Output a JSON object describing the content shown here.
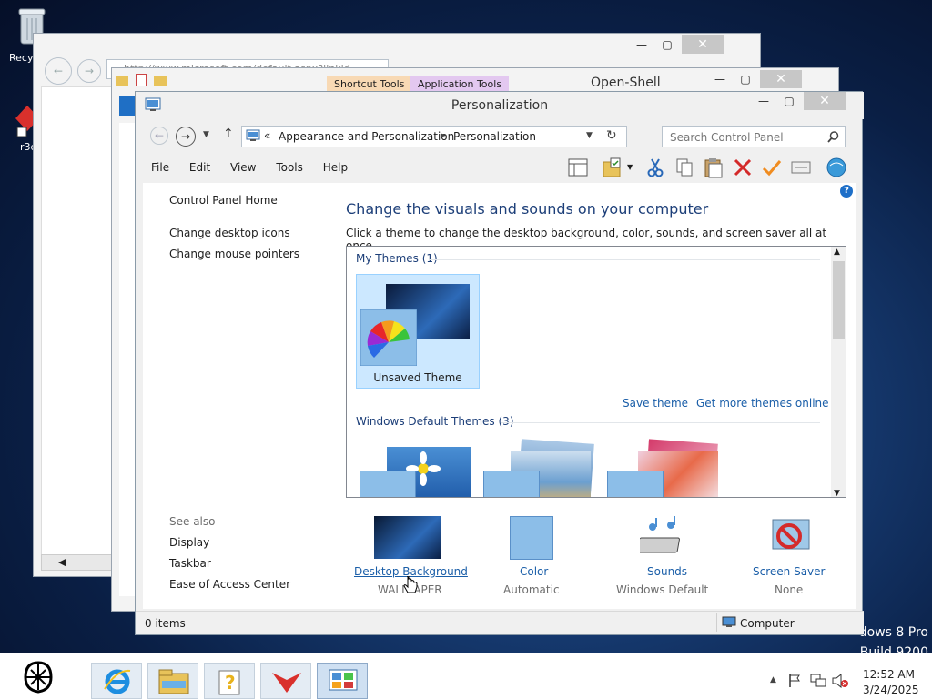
{
  "desktop": {
    "recycle_label": "Recyc",
    "app_label": "r3c",
    "watermark_line1": "dows 8 Pro",
    "watermark_line2": "Build 9200"
  },
  "bg_window_1": {
    "address_text": "http://www.microsoft.com/default.aspx?linkid=..."
  },
  "bg_window_2": {
    "shortcut_tools": "Shortcut Tools",
    "application_tools": "Application Tools",
    "title": "Open-Shell"
  },
  "window": {
    "title": "Personalization",
    "breadcrumb": {
      "root_chevron": "«",
      "item1": "Appearance and Personalization",
      "sep": "►",
      "item2": "Personalization"
    },
    "search_placeholder": "Search Control Panel",
    "menu": [
      "File",
      "Edit",
      "View",
      "Tools",
      "Help"
    ],
    "sidebar": {
      "home": "Control Panel Home",
      "links": [
        "Change desktop icons",
        "Change mouse pointers"
      ],
      "see_also_title": "See also",
      "see_also": [
        "Display",
        "Taskbar",
        "Ease of Access Center"
      ]
    },
    "main": {
      "heading": "Change the visuals and sounds on your computer",
      "subtext": "Click a theme to change the desktop background, color, sounds, and screen saver all at once.",
      "my_themes": "My Themes (1)",
      "unsaved_theme": "Unsaved Theme",
      "save_theme": "Save theme",
      "get_more": "Get more themes online",
      "default_themes": "Windows Default Themes (3)"
    },
    "bottom_items": [
      {
        "title": "Desktop Background",
        "sub": "WALLPAPER"
      },
      {
        "title": "Color",
        "sub": "Automatic"
      },
      {
        "title": "Sounds",
        "sub": "Windows Default"
      },
      {
        "title": "Screen Saver",
        "sub": "None"
      }
    ],
    "status": {
      "items": "0 items",
      "computer": "Computer"
    }
  },
  "taskbar": {
    "time": "12:52 AM",
    "date": "3/24/2025"
  },
  "colors": {
    "accent": "#1a5ea8",
    "selection": "#cce8ff",
    "titlebar": "#f0f0f0"
  }
}
